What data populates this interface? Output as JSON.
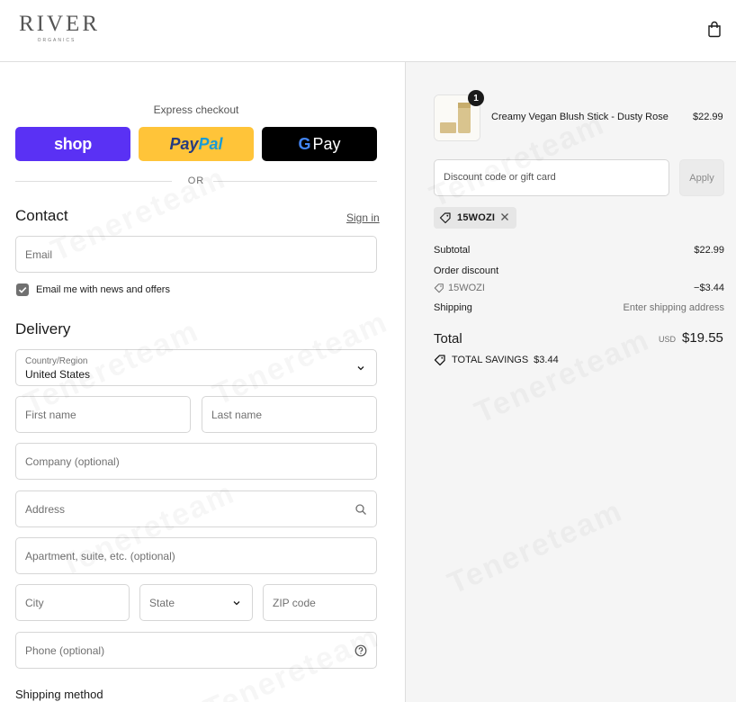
{
  "brand": {
    "name": "RIVER",
    "sub": "ORGANICS"
  },
  "watermark": "Tenereteam",
  "express": {
    "title": "Express checkout",
    "shop_label": "shop",
    "paypal_part1": "Pay",
    "paypal_part2": "Pal",
    "gpay_g": "G",
    "gpay_label": "Pay",
    "or_text": "OR"
  },
  "contact": {
    "title": "Contact",
    "sign_in": "Sign in",
    "email_placeholder": "Email",
    "newsletter_label": "Email me with news and offers",
    "newsletter_checked": true
  },
  "delivery": {
    "title": "Delivery",
    "country_label": "Country/Region",
    "country_value": "United States",
    "first_name": "First name",
    "last_name": "Last name",
    "company": "Company (optional)",
    "address": "Address",
    "apartment": "Apartment, suite, etc. (optional)",
    "city": "City",
    "state": "State",
    "zip": "ZIP code",
    "phone": "Phone (optional)"
  },
  "shipping_method": {
    "title": "Shipping method"
  },
  "order": {
    "product": {
      "name": "Creamy Vegan Blush Stick - Dusty Rose",
      "price": "$22.99",
      "quantity": "1"
    },
    "discount_placeholder": "Discount code or gift card",
    "apply_label": "Apply",
    "applied_code": "15WOZI",
    "subtotal_label": "Subtotal",
    "subtotal_value": "$22.99",
    "order_discount_label": "Order discount",
    "order_discount_code": "15WOZI",
    "order_discount_value": "−$3.44",
    "shipping_label": "Shipping",
    "shipping_value": "Enter shipping address",
    "total_label": "Total",
    "currency": "USD",
    "total_value": "$19.55",
    "savings_label": "TOTAL SAVINGS",
    "savings_value": "$3.44"
  },
  "colors": {
    "shop": "#5a31f4",
    "paypal": "#ffc439",
    "gpay": "#000000",
    "summary_bg": "#f5f5f5"
  }
}
